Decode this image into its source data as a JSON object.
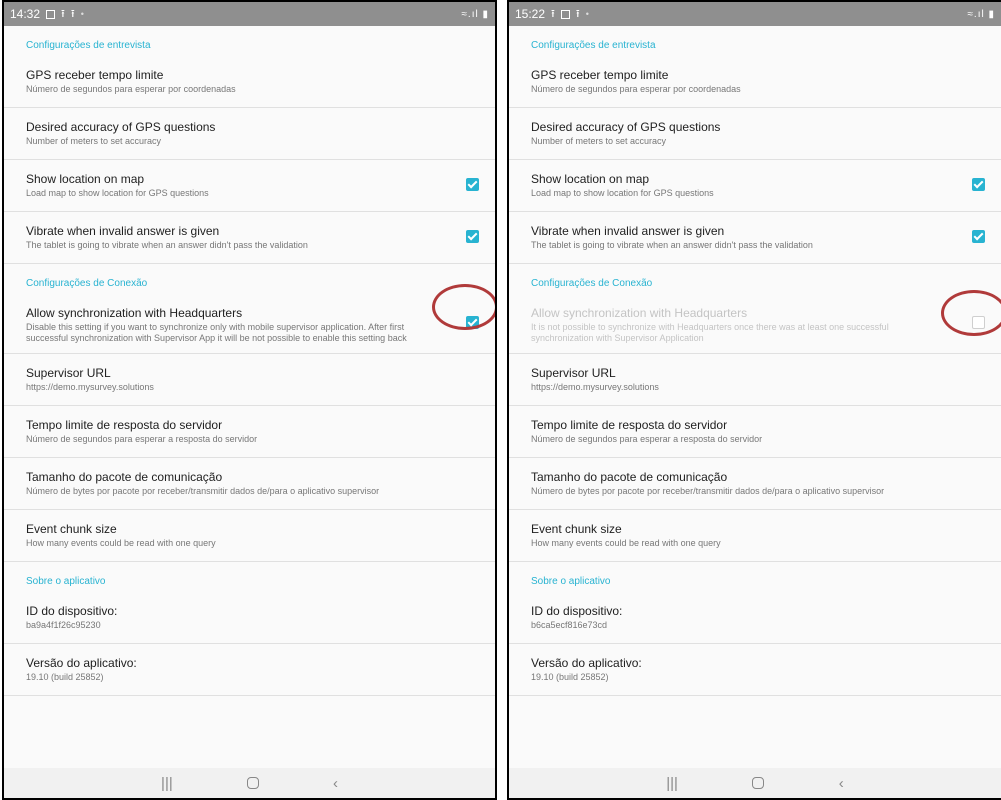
{
  "left": {
    "status": {
      "time": "14:32",
      "right": "≈.ıl ▮"
    },
    "sections": {
      "interview": "Configurações de entrevista",
      "connection": "Configurações de Conexão",
      "about": "Sobre o aplicativo"
    },
    "items": {
      "gps_timeout": {
        "title": "GPS receber tempo limite",
        "summary": "Número de segundos para esperar por coordenadas"
      },
      "gps_accuracy": {
        "title": "Desired accuracy of GPS questions",
        "summary": "Number of meters to set accuracy"
      },
      "show_map": {
        "title": "Show location on map",
        "summary": "Load map to show location for GPS questions",
        "checked": true
      },
      "vibrate": {
        "title": "Vibrate when invalid answer is given",
        "summary": "The tablet is going to vibrate when an answer didn't pass the validation",
        "checked": true
      },
      "allow_sync": {
        "title": "Allow synchronization with Headquarters",
        "summary": "Disable this setting if you want to synchronize only with mobile supervisor application. After first successful synchronization with Supervisor App it will be not possible to enable this setting back",
        "checked": true
      },
      "supervisor_url": {
        "title": "Supervisor URL",
        "summary": "https://demo.mysurvey.solutions"
      },
      "server_timeout": {
        "title": "Tempo limite de resposta do servidor",
        "summary": "Número de segundos para esperar a resposta do servidor"
      },
      "packet_size": {
        "title": "Tamanho do pacote de comunicação",
        "summary": "Número de bytes por pacote por receber/transmitir dados de/para o aplicativo supervisor"
      },
      "event_chunk": {
        "title": "Event chunk size",
        "summary": "How many events could be read with one query"
      },
      "device_id": {
        "title": "ID do dispositivo:",
        "summary": "ba9a4f1f26c95230"
      },
      "app_version": {
        "title": "Versão do aplicativo:",
        "summary": "19.10 (build 25852)"
      }
    }
  },
  "right": {
    "status": {
      "time": "15:22",
      "right": "≈.ıl ▮"
    },
    "sections": {
      "interview": "Configurações de entrevista",
      "connection": "Configurações de Conexão",
      "about": "Sobre o aplicativo"
    },
    "items": {
      "gps_timeout": {
        "title": "GPS receber tempo limite",
        "summary": "Número de segundos para esperar por coordenadas"
      },
      "gps_accuracy": {
        "title": "Desired accuracy of GPS questions",
        "summary": "Number of meters to set accuracy"
      },
      "show_map": {
        "title": "Show location on map",
        "summary": "Load map to show location for GPS questions",
        "checked": true
      },
      "vibrate": {
        "title": "Vibrate when invalid answer is given",
        "summary": "The tablet is going to vibrate when an answer didn't pass the validation",
        "checked": true
      },
      "allow_sync": {
        "title": "Allow synchronization with Headquarters",
        "summary": "It is not possible to synchronize with Headquarters once there was at least one successful synchronization with Supervisor Application",
        "checked": false,
        "disabled": true
      },
      "supervisor_url": {
        "title": "Supervisor URL",
        "summary": "https://demo.mysurvey.solutions"
      },
      "server_timeout": {
        "title": "Tempo limite de resposta do servidor",
        "summary": "Número de segundos para esperar a resposta do servidor"
      },
      "packet_size": {
        "title": "Tamanho do pacote de comunicação",
        "summary": "Número de bytes por pacote por receber/transmitir dados de/para o aplicativo supervisor"
      },
      "event_chunk": {
        "title": "Event chunk size",
        "summary": "How many events could be read with one query"
      },
      "device_id": {
        "title": "ID do dispositivo:",
        "summary": "b6ca5ecf816e73cd"
      },
      "app_version": {
        "title": "Versão do aplicativo:",
        "summary": "19.10 (build 25852)"
      }
    }
  },
  "navbar": {
    "recents": "|||",
    "back": "‹"
  },
  "colors": {
    "accent": "#28b3d1",
    "highlight": "#b03a3a",
    "statusbar": "#8f8f8f"
  }
}
